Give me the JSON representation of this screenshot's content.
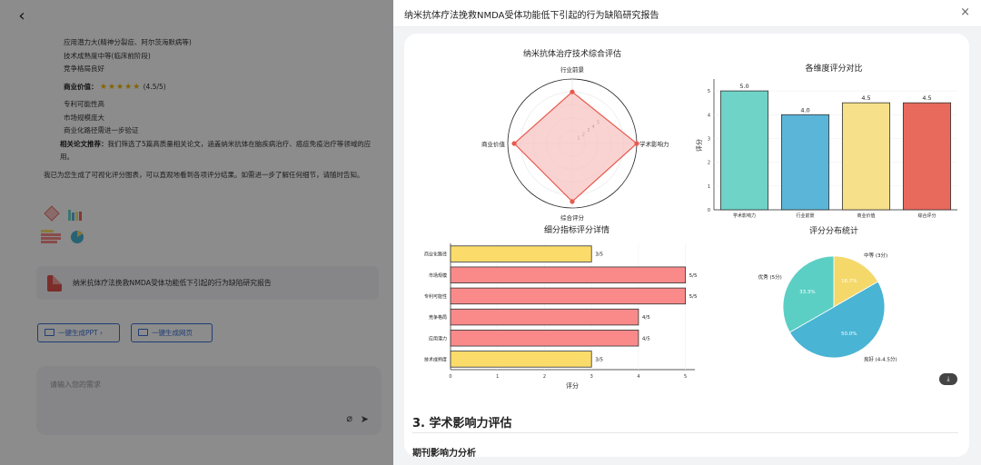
{
  "chat": {
    "lines_block1": [
      "应用潜力大(精神分裂症、阿尔茨海默病等)",
      "技术成熟度中等(临床前阶段)",
      "竞争格局良好"
    ],
    "commercial_label": "商业价值：",
    "commercial_stars": "★★★★★",
    "commercial_score": "(4.5/5)",
    "lines_block2": [
      "专利可能性高",
      "市场规模庞大",
      "商业化路径需进一步验证"
    ],
    "related_label": "相关论文推荐：",
    "related_text": "我们筛选了5篇高质量相关论文，涵盖纳米抗体在脑疾病治疗、癌症免疫治疗等领域的应用。",
    "summary_text": "我已为您生成了可视化评分图表，可以直观地看到各项评分结果。如需进一步了解任何细节，请随时告知。",
    "file_name": "纳米抗体疗法挽救NMDA受体功能低下引起的行为缺陷研究报告",
    "btn_ppt": "一键生成PPT",
    "btn_ppt_arrow": "›",
    "btn_web": "一键生成网页",
    "input_placeholder": "请输入您的需求"
  },
  "panel": {
    "title": "纳米抗体疗法挽救NMDA受体功能低下引起的行为缺陷研究报告",
    "close": "×",
    "section3_title": "3. 学术影响力评估",
    "section3_sub": "期刊影响力分析",
    "download_icon": "⤓"
  },
  "colors": {
    "radar_line": "#e8594f",
    "radar_fill": "#f7c4c1",
    "bar_teal": "#6fd3c8",
    "bar_blue": "#5bb5d8",
    "bar_yellow": "#f7e08a",
    "bar_red": "#e86a5c",
    "hbar_yellow": "#fbdc6a",
    "hbar_red": "#fa8a8a",
    "pie_yellow": "#f5d86a",
    "pie_blue": "#49b4d4",
    "pie_teal": "#5ccfc4"
  },
  "chart_data": [
    {
      "type": "radar",
      "title": "纳米抗体治疗技术综合评估",
      "axes": [
        "行业前景",
        "学术影响力",
        "综合评分",
        "商业价值"
      ],
      "values": [
        4.0,
        5.0,
        4.5,
        4.5
      ],
      "rmax": 5,
      "rticks": [
        "1",
        "2",
        "3",
        "4",
        "5"
      ]
    },
    {
      "type": "bar",
      "title": "各维度评分对比",
      "categories": [
        "学术影响力",
        "行业前景",
        "商业价值",
        "综合评分"
      ],
      "values": [
        5.0,
        4.0,
        4.5,
        4.5
      ],
      "value_labels": [
        "5.0",
        "4.0",
        "4.5",
        "4.5"
      ],
      "ylabel": "评分",
      "ylim": [
        0,
        5.5
      ],
      "yticks": [
        "0",
        "1",
        "2",
        "3",
        "4",
        "5"
      ]
    },
    {
      "type": "bar",
      "orientation": "horizontal",
      "title": "细分指标评分详情",
      "categories": [
        "商业化路径",
        "市场规模",
        "专利可能性",
        "竞争格局",
        "应用潜力",
        "技术成熟度"
      ],
      "values": [
        3,
        5,
        5,
        4,
        4,
        3
      ],
      "value_labels": [
        "3/5",
        "5/5",
        "5/5",
        "4/5",
        "4/5",
        "3/5"
      ],
      "xlabel": "评分",
      "xlim": [
        0,
        5.2
      ],
      "xticks": [
        "0",
        "1",
        "2",
        "3",
        "4",
        "5"
      ]
    },
    {
      "type": "pie",
      "title": "评分分布统计",
      "slices": [
        {
          "label": "中等 (3分)",
          "value": 16.7,
          "pct_label": "16.7%"
        },
        {
          "label": "良好 (4-4.5分)",
          "value": 50.0,
          "pct_label": "50.0%"
        },
        {
          "label": "优秀 (5分)",
          "value": 33.3,
          "pct_label": "33.3%"
        }
      ]
    }
  ]
}
